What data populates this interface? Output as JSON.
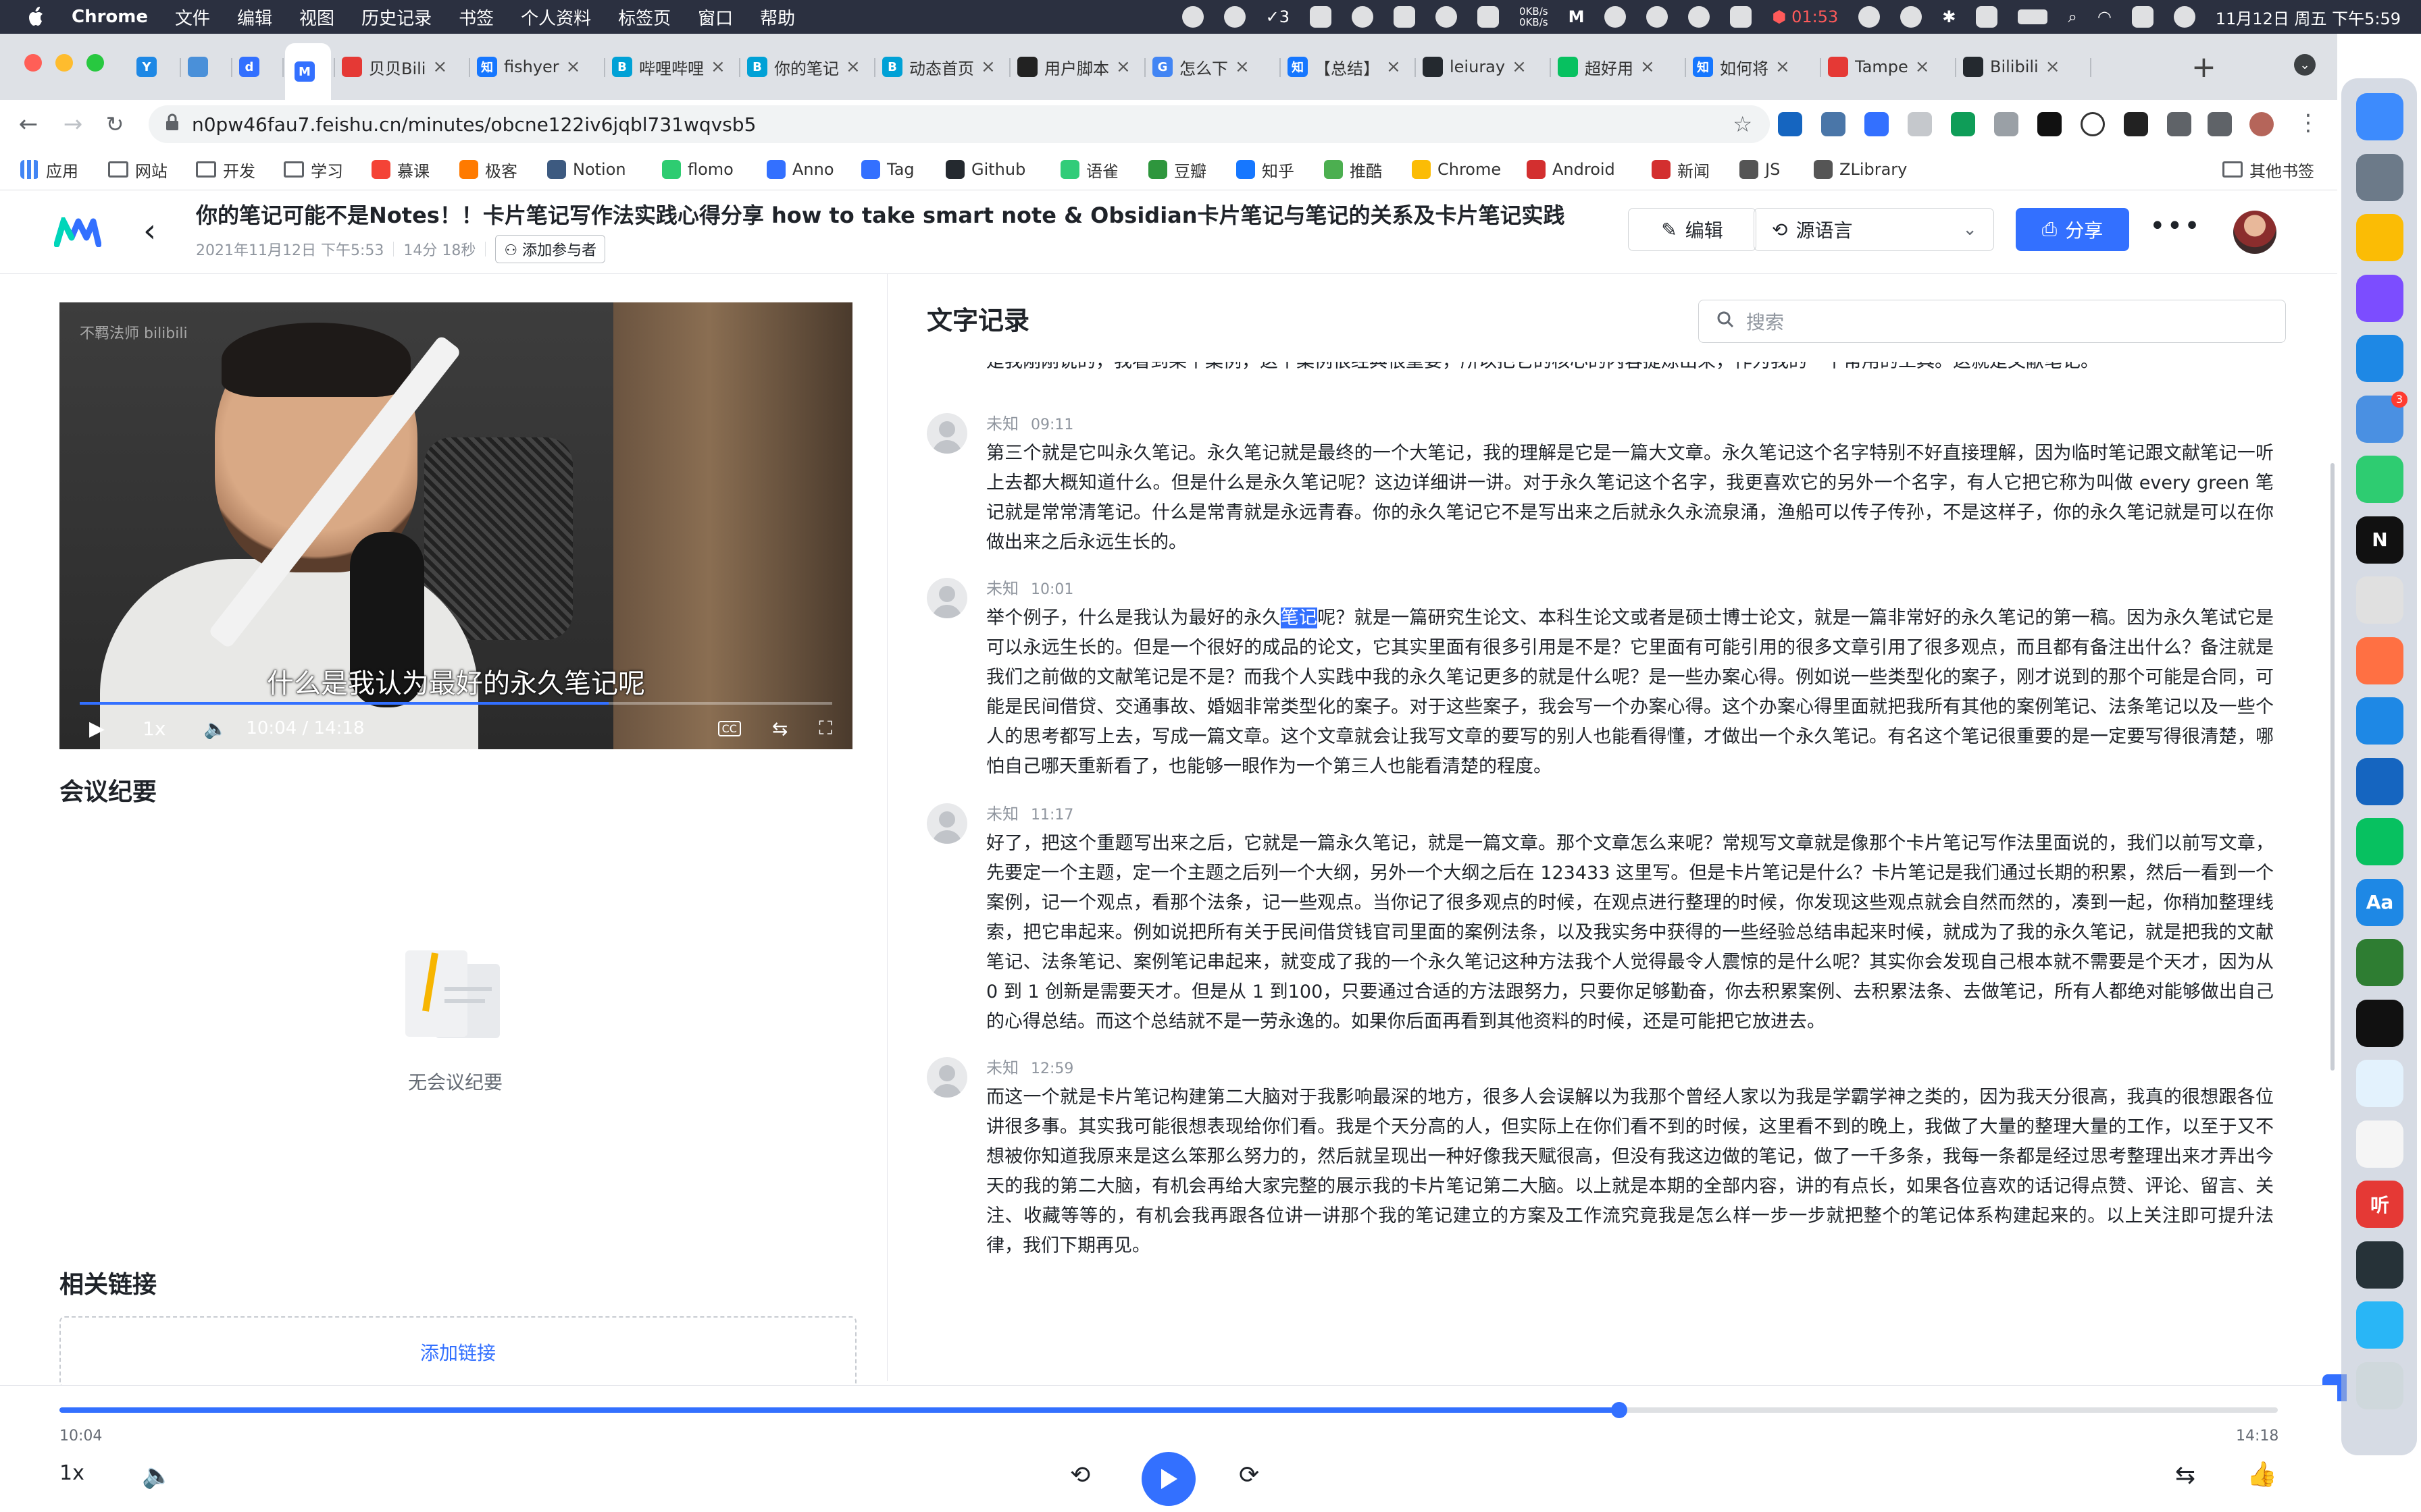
{
  "menubar": {
    "app_name": "Chrome",
    "items": [
      "文件",
      "编辑",
      "视图",
      "历史记录",
      "书签",
      "个人资料",
      "标签页",
      "窗口",
      "帮助"
    ],
    "tray": {
      "badge_count": "3",
      "net_up": "0KB/s",
      "net_down": "0KB/s",
      "timer": "01:53",
      "datetime": "11月12日 周五 下午5:59"
    }
  },
  "browser": {
    "tabs": [
      {
        "label": "",
        "fav_color": "#1e88e5",
        "fav_text": "Y"
      },
      {
        "label": "",
        "fav_color": "#4a90d9",
        "fav_text": ""
      },
      {
        "label": "",
        "fav_color": "#3370ff",
        "fav_text": "d"
      },
      {
        "label": "",
        "fav_color": "#3370ff",
        "fav_text": "M",
        "active": true
      },
      {
        "label": "贝贝Bili",
        "fav_color": "#e53935",
        "fav_text": ""
      },
      {
        "label": "fishyer",
        "fav_color": "#1677ff",
        "fav_text": "知"
      },
      {
        "label": "哔哩哔哩",
        "fav_color": "#00a1d6",
        "fav_text": "B"
      },
      {
        "label": "你的笔记",
        "fav_color": "#00a1d6",
        "fav_text": "B"
      },
      {
        "label": "动态首页",
        "fav_color": "#00a1d6",
        "fav_text": "B"
      },
      {
        "label": "用户脚本",
        "fav_color": "#222222",
        "fav_text": ""
      },
      {
        "label": "怎么下",
        "fav_color": "#4285f4",
        "fav_text": "G"
      },
      {
        "label": "【总结】",
        "fav_color": "#1677ff",
        "fav_text": "知"
      },
      {
        "label": "leiuray",
        "fav_color": "#24292f",
        "fav_text": ""
      },
      {
        "label": "超好用",
        "fav_color": "#07c160",
        "fav_text": ""
      },
      {
        "label": "如何将",
        "fav_color": "#1677ff",
        "fav_text": "知"
      },
      {
        "label": "Tampe",
        "fav_color": "#e53935",
        "fav_text": ""
      },
      {
        "label": "Bilibili",
        "fav_color": "#24292f",
        "fav_text": ""
      }
    ],
    "url": "n0pw46fau7.feishu.cn/minutes/obcne122iv6jqbl731wqvsb5",
    "bookmarks": [
      {
        "label": "应用",
        "type": "apps"
      },
      {
        "label": "网站",
        "type": "folder"
      },
      {
        "label": "开发",
        "type": "folder"
      },
      {
        "label": "学习",
        "type": "folder"
      },
      {
        "label": "慕课",
        "color": "#f44336"
      },
      {
        "label": "极客",
        "color": "#ff7a00"
      },
      {
        "label": "Notion",
        "color": "#3d5a80"
      },
      {
        "label": "flomo",
        "color": "#2ecc71"
      },
      {
        "label": "Anno",
        "color": "#3370ff"
      },
      {
        "label": "Tag",
        "color": "#3370ff"
      },
      {
        "label": "Github",
        "color": "#24292f"
      },
      {
        "label": "语雀",
        "color": "#31cc79"
      },
      {
        "label": "豆瓣",
        "color": "#2e963d"
      },
      {
        "label": "知乎",
        "color": "#1677ff"
      },
      {
        "label": "推酷",
        "color": "#4caf50"
      },
      {
        "label": "Chrome",
        "color": "#fbbc05"
      },
      {
        "label": "Android",
        "color": "#d32f2f"
      },
      {
        "label": "新闻",
        "color": "#d32f2f"
      },
      {
        "label": "JS",
        "color": "#555555"
      },
      {
        "label": "ZLibrary",
        "color": "#555555"
      }
    ],
    "other_bookmarks": "其他书签"
  },
  "app": {
    "title": "你的笔记可能不是Notes！！卡片笔记写作法实践心得分享 how to take smart note & Obsidian卡片笔记与笔记的关系及卡片笔记实践",
    "date": "2021年11月12日 下午5:53",
    "duration": "14分 18秒",
    "add_participant": "添加参与者",
    "edit_label": "编辑",
    "language_label": "源语言",
    "share_label": "分享",
    "video": {
      "watermark": "不羁法师 bilibili",
      "subtitle": "什么是我认为最好的永久笔记呢",
      "speed": "1x",
      "time": "10:04 / 14:18",
      "progress": 0.703
    },
    "summary_title": "会议纪要",
    "summary_empty": "无会议纪要",
    "links_title": "相关链接",
    "add_link": "添加链接",
    "transcript_title": "文字记录",
    "search_placeholder": "搜索",
    "top_text": "是我刚刚说的，我看到某个案例，这个案例很经典很重要，所以把它的核心的内容提炼出来，作为我的一个常用的工具。这就是文献笔记。",
    "segments": [
      {
        "speaker": "未知",
        "time": "09:11",
        "text": "第三个就是它叫永久笔记。永久笔记就是最终的一个大笔记，我的理解是它是一篇大文章。永久笔记这个名字特别不好直接理解，因为临时笔记跟文献笔记一听上去都大概知道什么。但是什么是永久笔记呢？这边详细讲一讲。对于永久笔记这个名字，我更喜欢它的另外一个名字，有人它把它称为叫做 every green 笔记就是常常清笔记。什么是常青就是永远青春。你的永久笔记它不是写出来之后就永久永流泉涌，渔船可以传子传孙，不是这样子，你的永久笔记就是可以在你做出来之后永远生长的。"
      },
      {
        "speaker": "未知",
        "time": "10:01",
        "text_before": "举个例子，什么是我认为最好的永久",
        "highlight": "笔记",
        "text_after": "呢？就是一篇研究生论文、本科生论文或者是硕士博士论文，就是一篇非常好的永久笔记的第一稿。因为永久笔试它是可以永远生长的。但是一个很好的成品的论文，它其实里面有很多引用是不是？它里面有可能引用的很多文章引用了很多观点，而且都有备注出什么？备注就是我们之前做的文献笔记是不是？而我个人实践中我的永久笔记更多的就是什么呢？是一些办案心得。例如说一些类型化的案子，刚才说到的那个可能是合同，可能是民间借贷、交通事故、婚姻非常类型化的案子。对于这些案子，我会写一个办案心得。这个办案心得里面就把我所有其他的案例笔记、法条笔记以及一些个人的思考都写上去，写成一篇文章。这个文章就会让我写文章的要写的别人也能看得懂，才做出一个永久笔记。有名这个笔记很重要的是一定要写得很清楚，哪怕自己哪天重新看了，也能够一眼作为一个第三人也能看清楚的程度。"
      },
      {
        "speaker": "未知",
        "time": "11:17",
        "text": "好了，把这个重题写出来之后，它就是一篇永久笔记，就是一篇文章。那个文章怎么来呢？常规写文章就是像那个卡片笔记写作法里面说的，我们以前写文章，先要定一个主题，定一个主题之后列一个大纲，另外一个大纲之后在 123433 这里写。但是卡片笔记是什么？卡片笔记是我们通过长期的积累，然后一看到一个案例，记一个观点，看那个法条，记一些观点。当你记了很多观点的时候，在观点进行整理的时候，你发现这些观点就会自然而然的，凑到一起，你稍加整理线索，把它串起来。例如说把所有关于民间借贷钱官司里面的案例法条，以及我实务中获得的一些经验总结串起来时候，就成为了我的永久笔记，就是把我的文献笔记、法条笔记、案例笔记串起来，就变成了我的一个永久笔记这种方法我个人觉得最令人震惊的是什么呢？其实你会发现自己根本就不需要是个天才，因为从 0 到 1 创新是需要天才。但是从 1 到100，只要通过合适的方法跟努力，只要你足够勤奋，你去积累案例、去积累法条、去做笔记，所有人都绝对能够做出自己的心得总结。而这个总结就不是一劳永逸的。如果你后面再看到其他资料的时候，还是可能把它放进去。"
      },
      {
        "speaker": "未知",
        "time": "12:59",
        "text": "而这一个就是卡片笔记构建第二大脑对于我影响最深的地方，很多人会误解以为我那个曾经人家以为我是学霸学神之类的，因为我天分很高，我真的很想跟各位讲很多事。其实我可能很想表现给你们看。我是个天分高的人，但实际上在你们看不到的时候，这里看不到的晚上，我做了大量的整理大量的工作，以至于又不想被你知道我原来是这么笨那么努力的，然后就呈现出一种好像我天赋很高，但没有我这边做的笔记，做了一千多条，我每一条都是经过思考整理出来才弄出今天的我的第二大脑，有机会再给大家完整的展示我的卡片笔记第二大脑。以上就是本期的全部内容，讲的有点长，如果各位喜欢的话记得点赞、评论、留言、关注、收藏等等的，有机会我再跟各位讲一讲那个我的笔记建立的方案及工作流究竟我是怎么样一步一步就把整个的笔记体系构建起来的。以上关注即可提升法律，我们下期再见。"
      }
    ],
    "player": {
      "current": "10:04",
      "total": "14:18",
      "speed": "1x",
      "progress": 0.703
    }
  },
  "dock": [
    {
      "name": "finder-icon",
      "color": "#3d8bfd"
    },
    {
      "name": "launchpad-icon",
      "color": "#6c7a89"
    },
    {
      "name": "chrome-icon",
      "color": "#fbbc05"
    },
    {
      "name": "obsidian-icon",
      "color": "#7c4dff"
    },
    {
      "name": "vscode-icon",
      "color": "#1e88e5"
    },
    {
      "name": "ticktick-icon",
      "color": "#4a90e2",
      "badge": "3"
    },
    {
      "name": "flomo-icon",
      "color": "#2ecc71"
    },
    {
      "name": "notion-icon",
      "color": "#111111",
      "text": "N"
    },
    {
      "name": "potion-icon",
      "color": "#e0e0e0"
    },
    {
      "name": "pencil-icon",
      "color": "#ff7043"
    },
    {
      "name": "feishu-icon",
      "color": "#1e88e5"
    },
    {
      "name": "android-studio-icon",
      "color": "#1565c0"
    },
    {
      "name": "wechat-icon",
      "color": "#07c160"
    },
    {
      "name": "dictionary-icon",
      "color": "#1e88e5",
      "text": "Aa"
    },
    {
      "name": "gear-green-icon",
      "color": "#2e7d32"
    },
    {
      "name": "terminal-icon",
      "color": "#111111"
    },
    {
      "name": "cloud-icon",
      "color": "#e3f2fd"
    },
    {
      "name": "qq-icon",
      "color": "#f5f5f5"
    },
    {
      "name": "listen-icon",
      "color": "#e53935",
      "text": "听"
    },
    {
      "name": "helm-icon",
      "color": "#263238"
    },
    {
      "name": "telegram-icon",
      "color": "#29b6f6"
    },
    {
      "name": "trash-icon",
      "color": "#cfd8dc"
    }
  ]
}
